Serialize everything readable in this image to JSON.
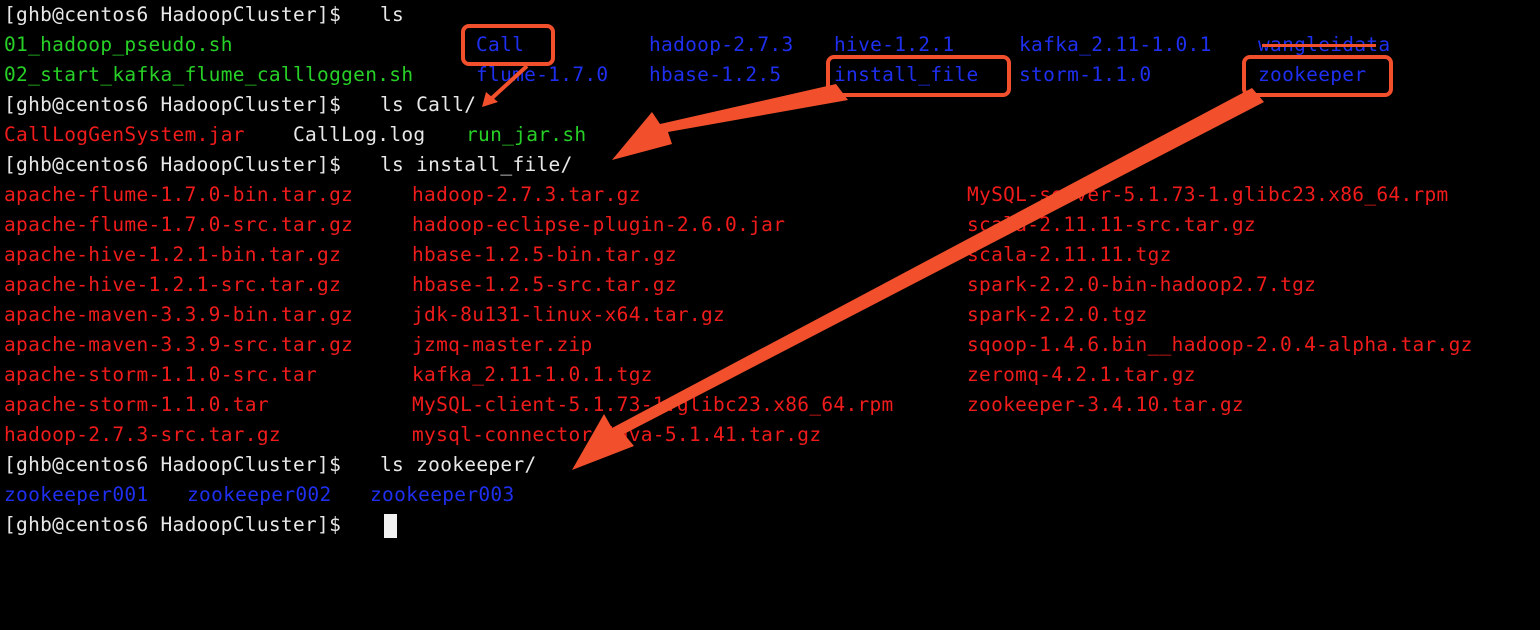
{
  "terminal": {
    "lines": [
      {
        "prompt": "[ghb@centos6 HadoopCluster]$ ",
        "command": "ls"
      },
      {
        "cols": [
          "01_hadoop_pseudo.sh",
          "Call",
          "hadoop-2.7.3",
          "hive-1.2.1",
          "kafka_2.11-1.0.1",
          "wangleidata"
        ]
      },
      {
        "cols": [
          "02_start_kafka_flume_callloggen.sh",
          "flume-1.7.0",
          "hbase-1.2.5",
          "install_file",
          "storm-1.1.0",
          "zookeeper"
        ]
      },
      {
        "prompt": "[ghb@centos6 HadoopCluster]$ ",
        "command": "ls Call/"
      },
      {
        "cols": [
          "CallLogGenSystem.jar",
          "CallLog.log",
          "run_jar.sh"
        ]
      },
      {
        "prompt": "[ghb@centos6 HadoopCluster]$ ",
        "command": "ls install_file/"
      },
      {
        "cols": [
          "apache-flume-1.7.0-bin.tar.gz",
          "hadoop-2.7.3.tar.gz",
          "MySQL-server-5.1.73-1.glibc23.x86_64.rpm"
        ]
      },
      {
        "cols": [
          "apache-flume-1.7.0-src.tar.gz",
          "hadoop-eclipse-plugin-2.6.0.jar",
          "scala-2.11.11-src.tar.gz"
        ]
      },
      {
        "cols": [
          "apache-hive-1.2.1-bin.tar.gz",
          "hbase-1.2.5-bin.tar.gz",
          "scala-2.11.11.tgz"
        ]
      },
      {
        "cols": [
          "apache-hive-1.2.1-src.tar.gz",
          "hbase-1.2.5-src.tar.gz",
          "spark-2.2.0-bin-hadoop2.7.tgz"
        ]
      },
      {
        "cols": [
          "apache-maven-3.3.9-bin.tar.gz",
          "jdk-8u131-linux-x64.tar.gz",
          "spark-2.2.0.tgz"
        ]
      },
      {
        "cols": [
          "apache-maven-3.3.9-src.tar.gz",
          "jzmq-master.zip",
          "sqoop-1.4.6.bin__hadoop-2.0.4-alpha.tar.gz"
        ]
      },
      {
        "cols": [
          "apache-storm-1.1.0-src.tar",
          "kafka_2.11-1.0.1.tgz",
          "zeromq-4.2.1.tar.gz"
        ]
      },
      {
        "cols": [
          "apache-storm-1.1.0.tar",
          "MySQL-client-5.1.73-1.glibc23.x86_64.rpm",
          "zookeeper-3.4.10.tar.gz"
        ]
      },
      {
        "cols": [
          "hadoop-2.7.3-src.tar.gz",
          "mysql-connector-java-5.1.41.tar.gz"
        ]
      },
      {
        "prompt": "[ghb@centos6 HadoopCluster]$ ",
        "command": "ls zookeeper/"
      },
      {
        "cols": [
          "zookeeper001",
          "zookeeper002",
          "zookeeper003"
        ]
      },
      {
        "prompt": "[ghb@centos6 HadoopCluster]$ ",
        "command": ""
      }
    ]
  },
  "colors": {
    "background": "#000000",
    "prompt": "#e8e8e8",
    "executable": "#27d027",
    "directory": "#1f2ff0",
    "archive": "#f01b1b",
    "annotation": "#f2502c"
  }
}
